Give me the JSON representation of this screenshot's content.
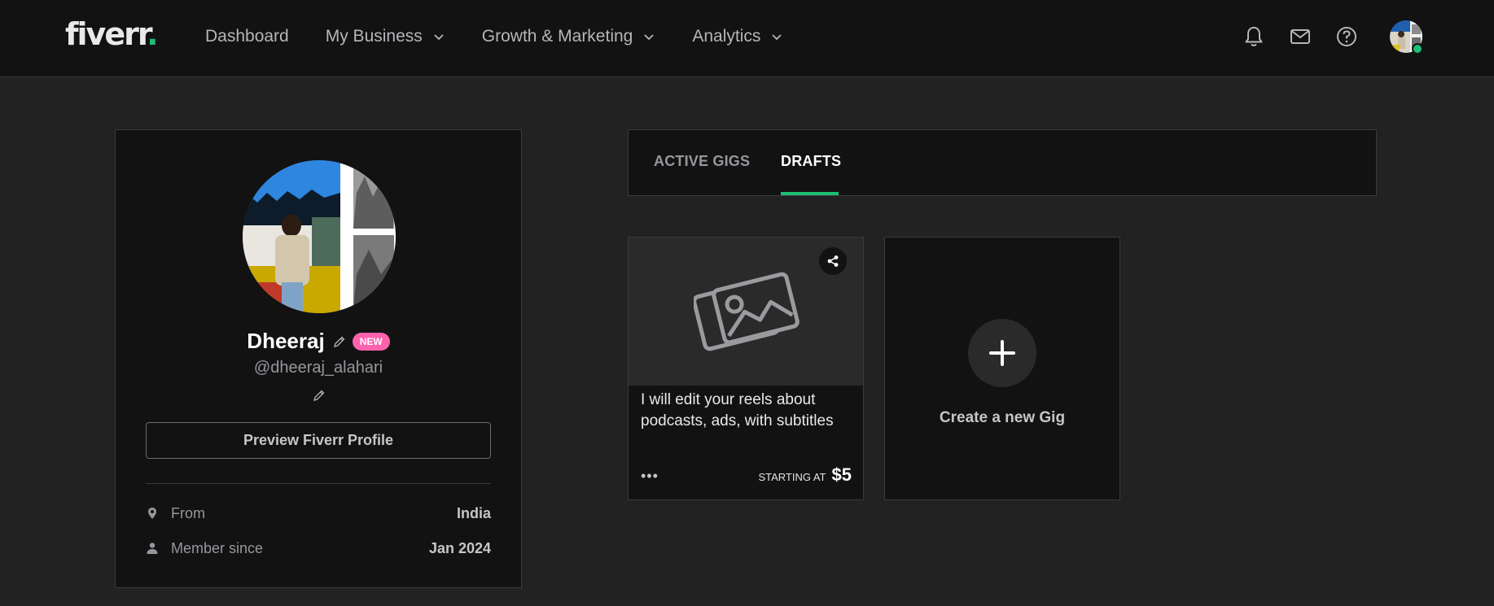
{
  "header": {
    "logo_text": "fiverr",
    "logo_dot": ".",
    "brand_color": "#1dbf73",
    "nav": [
      {
        "label": "Dashboard",
        "has_dropdown": false
      },
      {
        "label": "My Business",
        "has_dropdown": true
      },
      {
        "label": "Growth & Marketing",
        "has_dropdown": true
      },
      {
        "label": "Analytics",
        "has_dropdown": true
      }
    ],
    "icons": [
      "bell-icon",
      "envelope-icon",
      "help-circle-icon"
    ],
    "user_status": "online"
  },
  "profile": {
    "name": "Dheeraj",
    "badge": "NEW",
    "username": "@dheeraj_alahari",
    "preview_button": "Preview Fiverr Profile",
    "details": [
      {
        "icon": "location-pin-icon",
        "label": "From",
        "value": "India"
      },
      {
        "icon": "user-icon",
        "label": "Member since",
        "value": "Jan 2024"
      }
    ]
  },
  "tabs": {
    "items": [
      {
        "label": "ACTIVE GIGS",
        "active": false
      },
      {
        "label": "DRAFTS",
        "active": true
      }
    ]
  },
  "gigs": [
    {
      "title": "I will edit your reels about podcasts, ads, with subtitles",
      "more": "•••",
      "starting_label": "STARTING AT",
      "price": "$5"
    }
  ],
  "create_gig": {
    "label": "Create a new Gig",
    "plus": "+"
  }
}
